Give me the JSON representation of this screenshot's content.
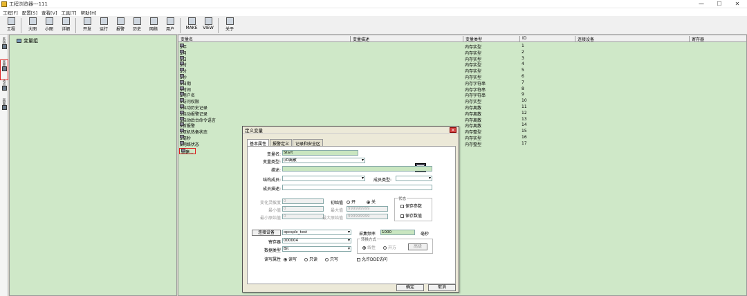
{
  "window": {
    "title": "工程浏览器---111",
    "controls": [
      "—",
      "☐",
      "✕"
    ]
  },
  "menu": [
    "工程[F]",
    "配置[S]",
    "查看[V]",
    "工具[T]",
    "帮助[H]"
  ],
  "toolbar": [
    {
      "label": "工程",
      "icon": "project-icon"
    },
    {
      "label": "大图",
      "icon": "large-icons-icon"
    },
    {
      "label": "小图",
      "icon": "small-icons-icon"
    },
    {
      "label": "详细",
      "icon": "details-icon"
    },
    {
      "label": "开发",
      "icon": "develop-icon"
    },
    {
      "label": "运行",
      "icon": "run-icon"
    },
    {
      "label": "报警",
      "icon": "alarm-icon"
    },
    {
      "label": "历史",
      "icon": "history-icon"
    },
    {
      "label": "网络",
      "icon": "network-icon"
    },
    {
      "label": "用户",
      "icon": "user-icon"
    },
    {
      "label": "MAKE",
      "icon": "make-icon"
    },
    {
      "label": "VIEW",
      "icon": "view-icon"
    },
    {
      "label": "关于",
      "icon": "about-icon"
    }
  ],
  "sidetabs": [
    "系统",
    "变量",
    "站点",
    "画面"
  ],
  "tree": {
    "root": "变量组"
  },
  "grid": {
    "columns": [
      "变量名",
      "变量描述",
      "变量类型",
      "ID",
      "连接设备",
      "寄存器"
    ],
    "rows": [
      [
        "$年",
        "",
        "内存实型",
        "1"
      ],
      [
        "$月",
        "",
        "内存实型",
        "2"
      ],
      [
        "$日",
        "",
        "内存实型",
        "3"
      ],
      [
        "$时",
        "",
        "内存实型",
        "4"
      ],
      [
        "$分",
        "",
        "内存实型",
        "5"
      ],
      [
        "$秒",
        "",
        "内存实型",
        "6"
      ],
      [
        "$日期",
        "",
        "内存字符串",
        "7"
      ],
      [
        "$时间",
        "",
        "内存字符串",
        "8"
      ],
      [
        "$用户名",
        "",
        "内存字符串",
        "9"
      ],
      [
        "$访问权限",
        "",
        "内存实型",
        "10"
      ],
      [
        "$启动历史记录",
        "",
        "内存离散",
        "11"
      ],
      [
        "$启动报警记录",
        "",
        "内存离散",
        "12"
      ],
      [
        "$启动后台命令语言",
        "",
        "内存离散",
        "13"
      ],
      [
        "$新报警",
        "",
        "内存离散",
        "14"
      ],
      [
        "$双机热备状态",
        "",
        "内存整型",
        "15"
      ],
      [
        "$毫秒",
        "",
        "内存实型",
        "16"
      ],
      [
        "$网络状态",
        "",
        "内存整型",
        "17"
      ]
    ],
    "new_row": "新建..."
  },
  "dialog": {
    "title": "定义变量",
    "close": "✕",
    "tabs": [
      "基本属性",
      "报警定义",
      "记录和安全区"
    ],
    "labels": {
      "var_name": "变量名:",
      "var_type": "变量类型:",
      "desc": "描述:",
      "struct_member": "结构成员:",
      "member_type": "成员类型:",
      "member_desc": "成员描述:",
      "change_sens": "变化灵敏度",
      "min": "最小值",
      "min_raw": "最小原始值",
      "init": "初始值",
      "max": "最大值",
      "max_raw": "最大原始值",
      "state": "状态",
      "save_param": "保存参数",
      "save_value": "保存数值",
      "device": "连接设备",
      "register": "寄存器",
      "data_type": "数据类型",
      "rw": "读写属性",
      "sample": "采集频率",
      "ms": "毫秒",
      "convert": "转换方式",
      "linear": "线性",
      "sqrt": "开方",
      "advanced": "高级",
      "on": "开",
      "off": "关",
      "read_write": "读写",
      "read_only": "只读",
      "write_only": "只写",
      "dde": "允许DDE访问",
      "ok": "确定",
      "cancel": "取消"
    },
    "values": {
      "var_name": "Start",
      "var_type": "I/O离散",
      "change_sens": "0",
      "min": "0",
      "min_raw": "0",
      "max": "999999999",
      "max_raw": "999999999",
      "device": "opcsplc_test",
      "register": "000004",
      "data_type": "Bit",
      "sample": "1000"
    }
  }
}
